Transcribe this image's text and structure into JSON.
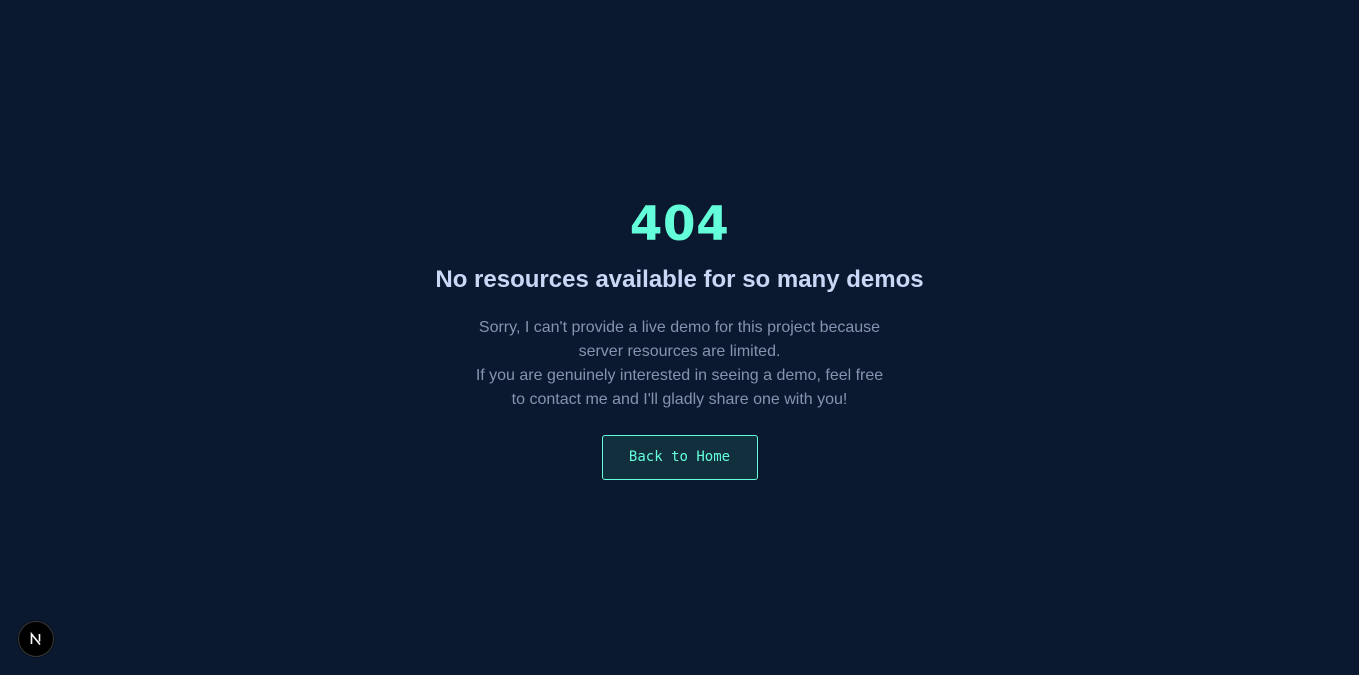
{
  "error": {
    "code": "404",
    "title": "No resources available for so many demos",
    "message_lines": [
      "Sorry, I can't provide a live demo for this project because",
      "server resources are limited.",
      "If you are genuinely interested in seeing a demo, feel free",
      "to contact me and I'll gladly share one with you!"
    ],
    "back_button_label": "Back to Home"
  },
  "dev_badge": {
    "icon": "nextjs-logo-icon"
  },
  "colors": {
    "background": "#0a192f",
    "accent": "#64ffda",
    "heading": "#ccd6f6",
    "body_text": "#8892b0",
    "button_background": "#112f3d"
  }
}
